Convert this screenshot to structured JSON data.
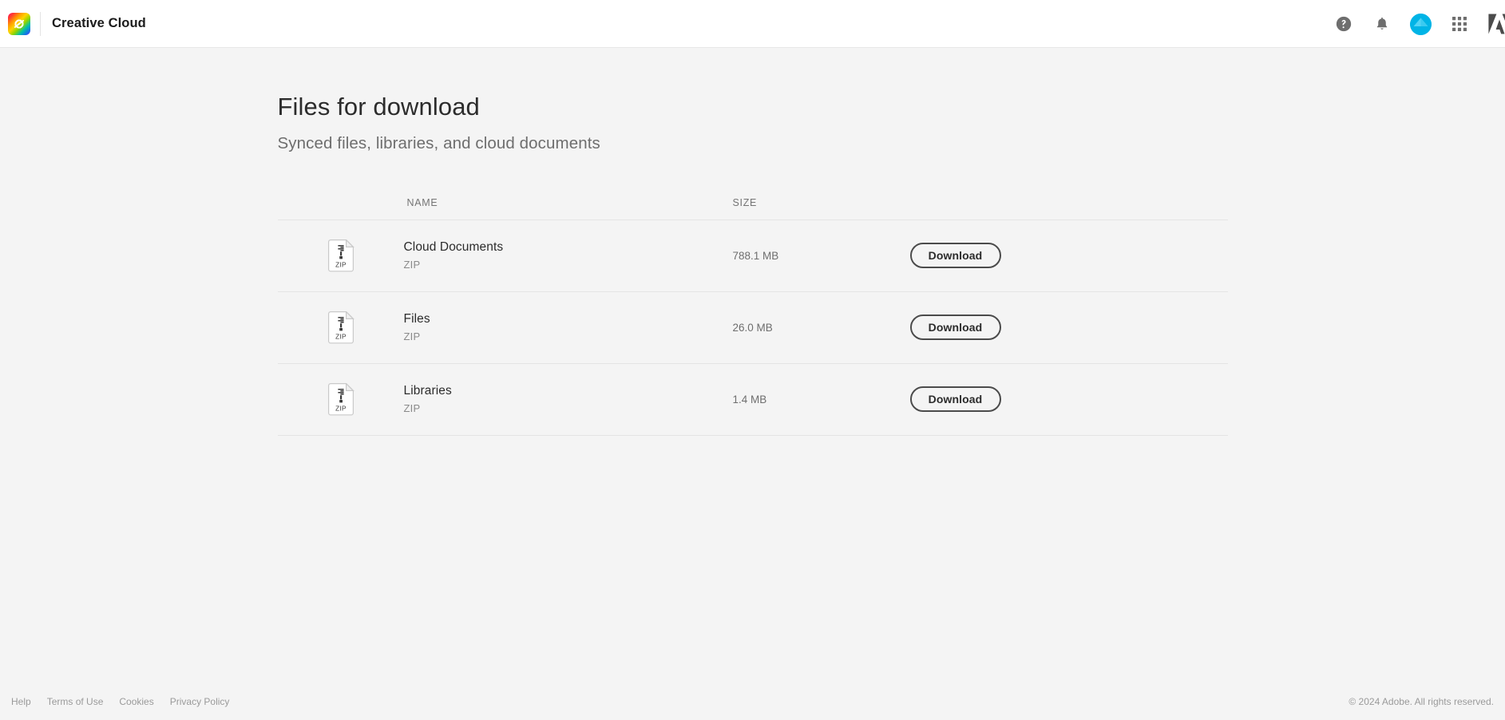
{
  "appbar": {
    "logo_icon": "creative-cloud-logo",
    "title": "Creative Cloud",
    "help_icon": "help-circle-icon",
    "notifications_icon": "bell-icon",
    "avatar_icon": "user-avatar",
    "apps_grid_icon": "app-grid-icon",
    "adobe_icon": "adobe-logo-icon",
    "avatar_color": "#00b4e6"
  },
  "page": {
    "title": "Files for download",
    "subtitle": "Synced files, libraries, and cloud documents"
  },
  "table": {
    "columns": {
      "name": "NAME",
      "size": "SIZE"
    },
    "rows": [
      {
        "icon": "zip-file-icon",
        "icon_label": "ZIP",
        "name": "Cloud Documents",
        "type": "ZIP",
        "size": "788.1 MB",
        "action": "Download"
      },
      {
        "icon": "zip-file-icon",
        "icon_label": "ZIP",
        "name": "Files",
        "type": "ZIP",
        "size": "26.0 MB",
        "action": "Download"
      },
      {
        "icon": "zip-file-icon",
        "icon_label": "ZIP",
        "name": "Libraries",
        "type": "ZIP",
        "size": "1.4 MB",
        "action": "Download"
      }
    ]
  },
  "footer": {
    "links": [
      "Help",
      "Terms of Use",
      "Cookies",
      "Privacy Policy"
    ],
    "copyright": "© 2024 Adobe. All rights reserved."
  }
}
